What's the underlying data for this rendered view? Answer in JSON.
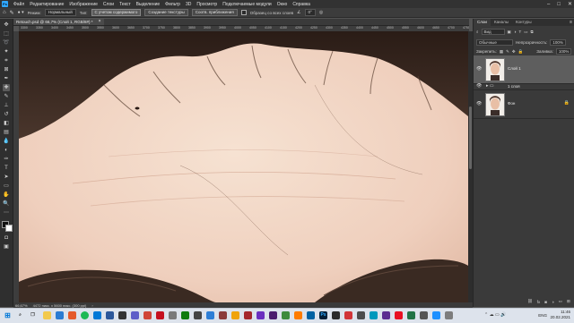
{
  "menu": {
    "logo": "Ps",
    "items": [
      "Файл",
      "Редактирование",
      "Изображение",
      "Слои",
      "Текст",
      "Выделение",
      "Фильтр",
      "3D",
      "Просмотр",
      "Подключаемые модули",
      "Окно",
      "Справка"
    ],
    "window_controls": [
      "–",
      "□",
      "✕"
    ]
  },
  "options": {
    "mode_label": "Режим:",
    "mode_value": "Нормальный",
    "type_label": "Тип:",
    "type_buttons": [
      "С учетом содержимого",
      "Создание текстуры",
      "Соотв. приближения"
    ],
    "sample_label": "Образец со всех слоев",
    "angle_value": "0°"
  },
  "document": {
    "tab_title": "Retouch.psd @ 66,7% (Слой 1, RGB/8#) *",
    "close": "×"
  },
  "ruler": {
    "top_ticks": [
      "3300",
      "3350",
      "3400",
      "3450",
      "3500",
      "3550",
      "3600",
      "3650",
      "3700",
      "3750",
      "3800",
      "3850",
      "3900",
      "3950",
      "4000",
      "4050",
      "4100",
      "4150",
      "4200",
      "4250",
      "4300",
      "4350",
      "4400",
      "4450",
      "4500",
      "4550",
      "4600",
      "4650",
      "4700",
      "4750"
    ]
  },
  "status": {
    "zoom": "66,67%",
    "dims": "4472 пикс. x 5600 пикс. (300 ppi)"
  },
  "panels": {
    "tabs": [
      "Слои",
      "Каналы",
      "Контуры"
    ],
    "active_tab": "Слои",
    "search_placeholder": "Вид",
    "blend_mode": "Обычные",
    "opacity_label": "Непрозрачность:",
    "opacity_value": "100%",
    "lock_label": "Закрепить:",
    "fill_label": "Заливка:",
    "fill_value": "100%",
    "layers": [
      {
        "name": "Слой 1",
        "selected": true
      },
      {
        "name": "1 слоя",
        "selected": false
      },
      {
        "name": "Фон",
        "selected": false
      }
    ]
  },
  "taskbar": {
    "lang": "ENG",
    "time": "11:46",
    "date": "20.02.2021"
  },
  "colors": {
    "accent": "#31a8ff",
    "skin": "#f1d4c2",
    "hair": "#3a2a22",
    "selected_layer": "#5e5e5e"
  }
}
